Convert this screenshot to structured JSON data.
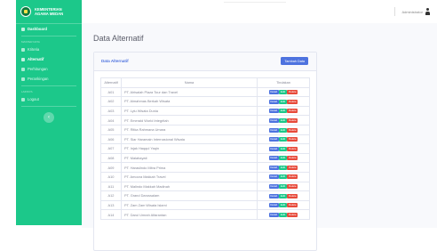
{
  "brand": {
    "line1": "KEMENTERIAN",
    "line2": "AGAMA MEDAN"
  },
  "sidebar": {
    "dashboard": "Dashboard",
    "heading_master": "MASTER DATA",
    "items": [
      "Kriteria",
      "Alternatif",
      "Perhitungan",
      "Perankingan"
    ],
    "heading_other": "LAINNYA",
    "logout": "Logout",
    "toggle": "‹"
  },
  "user": {
    "name": "Administrator"
  },
  "page": {
    "title": "Data Alternatif"
  },
  "card": {
    "title": "Data Alternatif",
    "add_button": "Tambah Data"
  },
  "table": {
    "headers": [
      "Alternatif",
      "Nama",
      "Tindakan"
    ],
    "actions": {
      "detail": "Detail",
      "edit": "Edit",
      "delete": "Delete"
    },
    "rows": [
      {
        "code": "A01",
        "name": "PT. Alrisalah Plaza Tour dan Travel"
      },
      {
        "code": "A02",
        "name": "PT. Almahmas Berkah Wisata"
      },
      {
        "code": "A03",
        "name": "PT. Lylu Wisata Dunia"
      },
      {
        "code": "A04",
        "name": "PT. Emerald World Integritah"
      },
      {
        "code": "A05",
        "name": "PT. Ritka Rahmana Umara"
      },
      {
        "code": "A06",
        "name": "PT. Siar Haramain Internasional Wisata"
      },
      {
        "code": "A07",
        "name": "PT. Injak Haqqul Yaqin"
      },
      {
        "code": "A08",
        "name": "PT. Malahayati"
      },
      {
        "code": "A09",
        "name": "PT. Haraslindo Mitra Prima"
      },
      {
        "code": "A10",
        "name": "PT. Amoora Makkah Travel"
      },
      {
        "code": "A11",
        "name": "PT. Malindo Makkah Madinah"
      },
      {
        "code": "A12",
        "name": "PT. Grand Darussalam"
      },
      {
        "code": "A13",
        "name": "PT. Zam Zam Wisata Islami"
      },
      {
        "code": "A14",
        "name": "PT. Darul Umrah Alfarantan"
      }
    ]
  }
}
